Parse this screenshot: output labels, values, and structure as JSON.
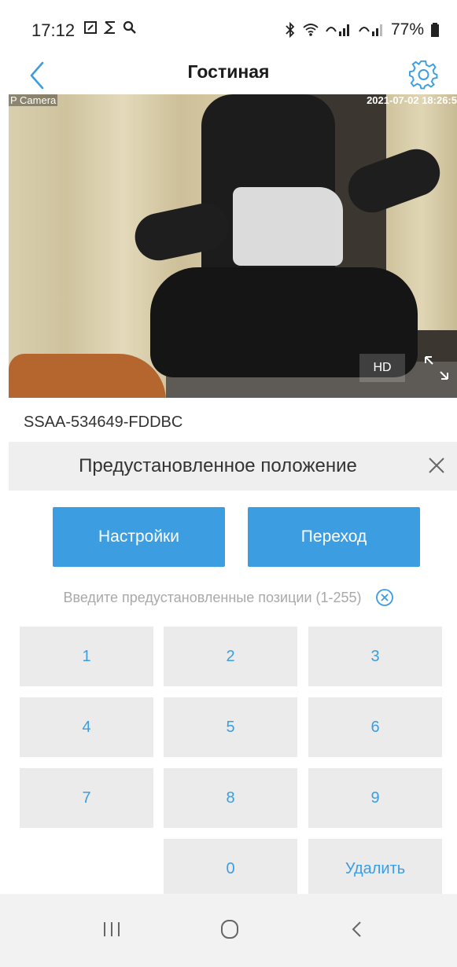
{
  "status_bar": {
    "time": "17:12",
    "battery": "77%"
  },
  "header": {
    "title": "Гостиная"
  },
  "video": {
    "camera_label": "P Camera",
    "timestamp": "2021-07-02 18:26:5",
    "quality_label": "HD"
  },
  "device": {
    "id": "SSAA-534649-FDDBC"
  },
  "preset": {
    "title": "Предустановленное положение",
    "settings_label": "Настройки",
    "goto_label": "Переход",
    "hint": "Введите предустановленные позиции (1-255)"
  },
  "keypad": {
    "k1": "1",
    "k2": "2",
    "k3": "3",
    "k4": "4",
    "k5": "5",
    "k6": "6",
    "k7": "7",
    "k8": "8",
    "k9": "9",
    "k0": "0",
    "delete": "Удалить"
  },
  "colors": {
    "accent": "#3c9de0",
    "key_bg": "#ebebeb",
    "panel_bg": "#efefef"
  }
}
